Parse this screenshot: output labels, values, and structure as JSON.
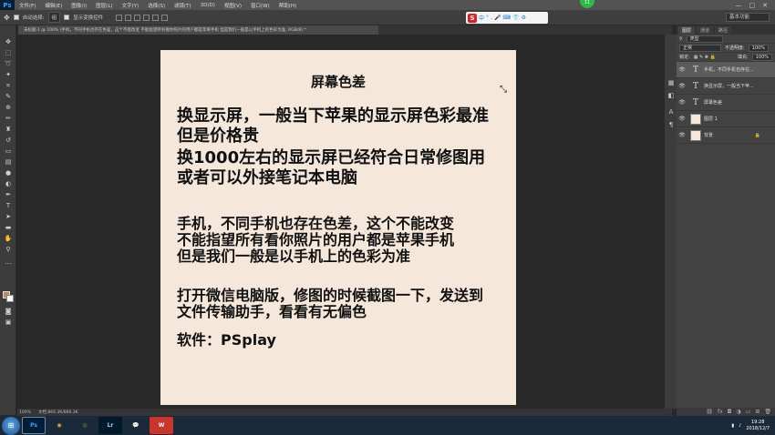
{
  "app": {
    "logo": "Ps",
    "menu": [
      "文件(F)",
      "编辑(E)",
      "图像(I)",
      "图层(L)",
      "文字(Y)",
      "选择(S)",
      "滤镜(T)",
      "3D(D)",
      "视图(V)",
      "窗口(W)",
      "帮助(H)"
    ],
    "window_controls": [
      "—",
      "□",
      "✕"
    ]
  },
  "options_bar": {
    "auto_select_label": "自动选择:",
    "auto_select_value": "组",
    "transform_label": "显示变换控件",
    "workspace": "基本功能",
    "badge": "11"
  },
  "ime": {
    "logo": "S",
    "items": [
      "中",
      "°",
      ",",
      "🎤",
      "⌨",
      "👕",
      "⚙"
    ]
  },
  "document": {
    "tab_title": "未标题-1 @ 100% (手机，不同手机也存在色差，这个不能改变  不能指望所有看你照片的用户都是苹果手机  但是我们一般是以手机上的色彩为准, RGB/8) *",
    "zoom": "100%",
    "doc_size": "文档:866.3K/866.3K"
  },
  "canvas": {
    "title": "屏幕色差",
    "lines": [
      "换显示屏，一般当下苹果的显示屏色彩最准",
      "但是价格贵",
      "换1000左右的显示屏已经符合日常修图用",
      "或者可以外接笔记本电脑",
      "手机，不同手机也存在色差，这个不能改变",
      "不能指望所有看你照片的用户都是苹果手机",
      "但是我们一般是以手机上的色彩为准",
      "打开微信电脑版，修图的时候截图一下，发送到",
      "文件传输助手，看看有无偏色",
      "软件：PSplay"
    ],
    "background_color": "#f6e7db"
  },
  "layers_panel": {
    "tabs": [
      "图层",
      "通道",
      "路径"
    ],
    "filter_kind": "类型",
    "blend_mode": "正常",
    "opacity_label": "不透明度:",
    "opacity_value": "100%",
    "lock_label": "锁定:",
    "fill_label": "填充:",
    "fill_value": "100%",
    "layers": [
      {
        "name": "手机，不同手机也存在...",
        "type": "text",
        "selected": true
      },
      {
        "name": "换显示屏，一般当下苹...",
        "type": "text",
        "selected": false
      },
      {
        "name": "屏幕色差",
        "type": "text",
        "selected": false
      },
      {
        "name": "图层 1",
        "type": "fill",
        "selected": false
      },
      {
        "name": "背景",
        "type": "fill",
        "selected": false,
        "locked": true
      }
    ]
  },
  "taskbar": {
    "apps": [
      "Ps",
      "◉",
      "◎",
      "Lr",
      "💬",
      "W"
    ],
    "time": "19:28",
    "date": "2018/12/7"
  }
}
